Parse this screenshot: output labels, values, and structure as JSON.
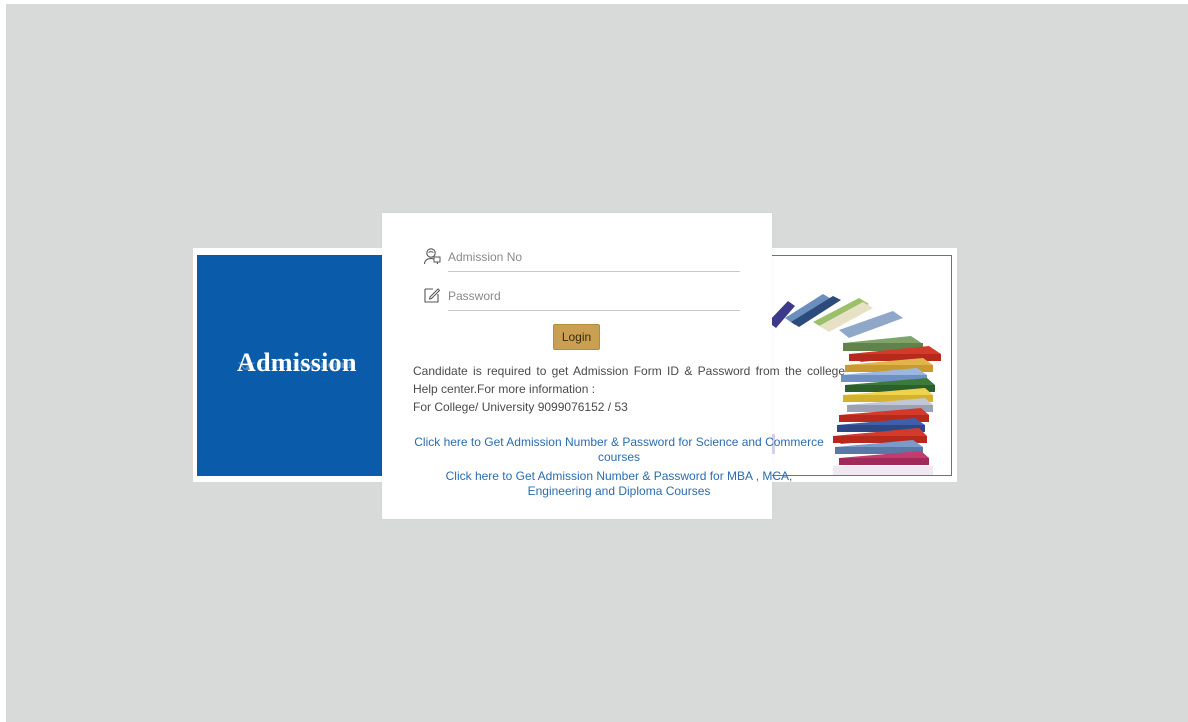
{
  "banner": {
    "title": "Admission"
  },
  "login": {
    "admission_placeholder": "Admission No",
    "password_placeholder": "Password",
    "button_label": "Login"
  },
  "info": {
    "line1": "Candidate is required to get Admission Form ID & Password from the college Help center.For more information :",
    "line2": "For College/ University 9099076152 / 53"
  },
  "links": {
    "science_commerce": "Click here to Get Admission Number & Password for Science and Commerce courses",
    "mba_mca": "Click here to Get Admission Number & Password for MBA , MCA, Engineering and Diploma Courses"
  },
  "icons": {
    "admission": "user-id-icon",
    "password": "edit-pencil-icon"
  },
  "colors": {
    "background": "#d7dad9",
    "banner_blue": "#0a5cab",
    "button": "#c9a052",
    "link": "#2a6db0"
  }
}
